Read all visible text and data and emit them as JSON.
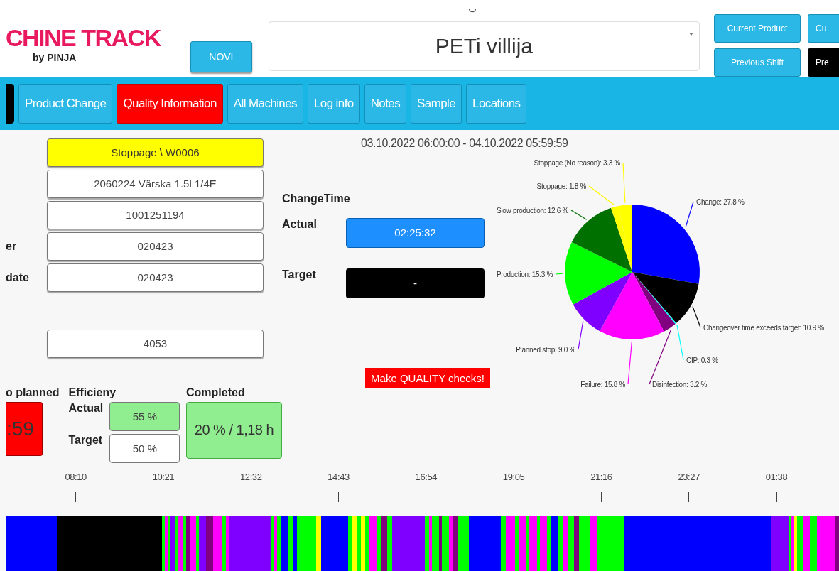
{
  "header": {
    "logo": "CHINE TRACK",
    "logo_sub": "by PINJA",
    "new_button": "NOVI",
    "product_select": {
      "value": "PETi villija"
    },
    "buttons": [
      {
        "label": "Current Product",
        "kind": "normal"
      },
      {
        "label": "Cu",
        "kind": "normal"
      },
      {
        "label": "Previous Shift",
        "kind": "normal"
      },
      {
        "label": "Pre",
        "kind": "dark"
      }
    ]
  },
  "tabs": [
    {
      "kind": "dark",
      "selected": false
    },
    {
      "label": "Product Change",
      "kind": "normal",
      "selected": false
    },
    {
      "label": "Quality Information",
      "kind": "normal",
      "selected": true
    },
    {
      "label": "All Machines",
      "kind": "normal",
      "selected": false
    },
    {
      "label": "Log info",
      "kind": "normal",
      "selected": false
    },
    {
      "label": "Notes",
      "kind": "normal",
      "selected": false
    },
    {
      "label": "Sample",
      "kind": "normal",
      "selected": false
    },
    {
      "label": "Locations",
      "kind": "normal",
      "selected": false
    }
  ],
  "fields": [
    {
      "value": "Stoppage \\ W0006",
      "kind": "status"
    },
    {
      "value": "2060224 Värska 1.5l 1/4E",
      "kind": "plain"
    },
    {
      "value": "1001251194",
      "kind": "plain"
    },
    {
      "label": "er",
      "value": "020423",
      "kind": "plain"
    },
    {
      "label": "date",
      "value": "020423",
      "kind": "plain"
    },
    {
      "value": "4053",
      "kind": "plain"
    }
  ],
  "period": "03.10.2022 06:00:00 - 04.10.2022 05:59:59",
  "change_time": {
    "title": "ChangeTime",
    "actual_label": "Actual",
    "actual": "02:25:32",
    "target_label": "Target",
    "target": "-"
  },
  "alert": "Make QUALITY checks!",
  "planned": {
    "label": "o planned",
    "value": ":59"
  },
  "efficiency": {
    "title": "Efficieny",
    "actual_label": "Actual",
    "actual": "55 %",
    "target_label": "Target",
    "target": "50 %"
  },
  "completed": {
    "title": "Completed",
    "value": "20 % / 1,18 h"
  },
  "timeline": {
    "ticks": [
      "08:10",
      "10:21",
      "12:32",
      "14:43",
      "16:54",
      "19:05",
      "21:16",
      "23:27",
      "01:38"
    ]
  },
  "chart_data": {
    "type": "pie",
    "values": [
      27.8,
      10.9,
      0.3,
      3.2,
      15.8,
      9.0,
      15.3,
      12.6,
      1.8,
      3.3
    ],
    "colors": [
      "#0000ff",
      "#000000",
      "#00ffff",
      "#800080",
      "#ff00ff",
      "#8000ff",
      "#00ff00",
      "#007000",
      "#ffff00",
      "#ffff00"
    ],
    "value_labels": [
      "Change: 27.8 %",
      "Changeover time exceeds target: 10.9 %",
      "CIP: 0.3 %",
      "Disinfection: 3.2 %",
      "Failure: 15.8 %",
      "Planned stop: 9.0 %",
      "Production: 15.3 %",
      "Slow production: 12.6 %",
      "Stoppage: 1.8 %",
      "Stoppage (No reason): 3.3 %"
    ]
  }
}
